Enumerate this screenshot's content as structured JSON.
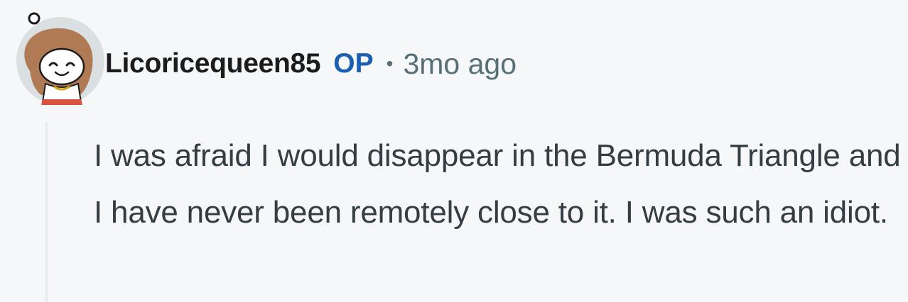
{
  "comment": {
    "author": "Licoricequeen85",
    "op_badge": "OP",
    "separator": "•",
    "timestamp": "3mo ago",
    "body": "I was afraid I would disappear in the Bermuda Triangle and I have never been remotely close to it. I was such an idiot.",
    "avatar_icon": "snoo-avatar-icon"
  },
  "colors": {
    "background": "#f6f7f8",
    "op_badge": "#1b5fb3",
    "meta_text": "#576f76",
    "body_text": "#333d42",
    "thread_line": "#e5ebee"
  }
}
